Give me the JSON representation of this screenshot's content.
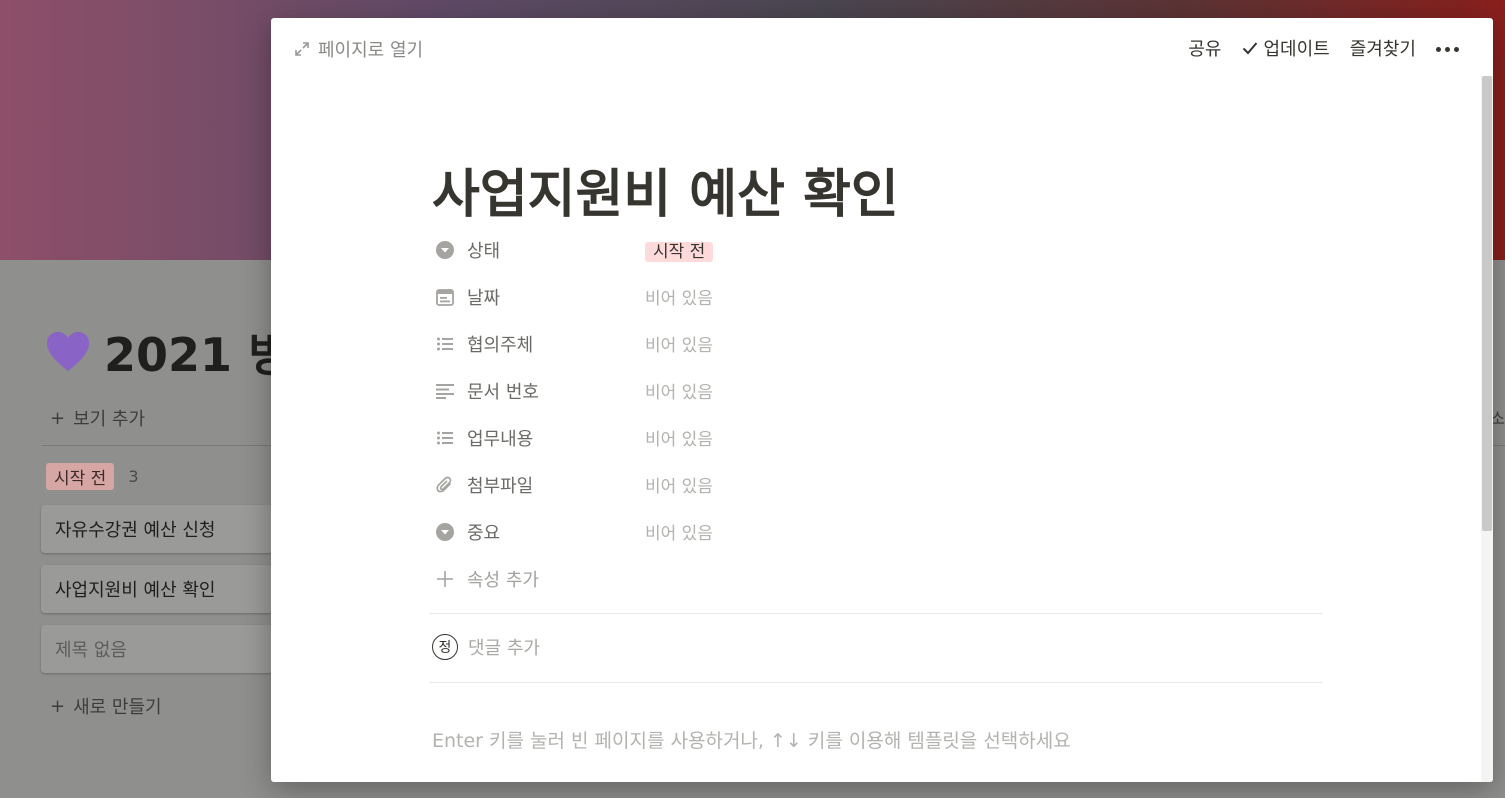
{
  "background": {
    "board_title": "2021 빙",
    "add_view": "보기 추가",
    "group": {
      "label": "시작 전",
      "count": "3"
    },
    "cards": [
      "자유수강권 예산 신청",
      "사업지원비 예산 확인",
      "제목 없음"
    ],
    "new_item": "새로 만들기",
    "right_edge_text": "소"
  },
  "modal": {
    "open_page": "페이지로 열기",
    "actions": {
      "share": "공유",
      "updates": "업데이트",
      "favorite": "즐겨찾기"
    },
    "title": "사업지원비 예산 확인",
    "properties": [
      {
        "icon": "select-icon",
        "name": "상태",
        "value": "시작 전",
        "type": "tag"
      },
      {
        "icon": "calendar-icon",
        "name": "날짜",
        "value": "비어 있음"
      },
      {
        "icon": "list-icon",
        "name": "협의주체",
        "value": "비어 있음"
      },
      {
        "icon": "text-icon",
        "name": "문서 번호",
        "value": "비어 있음"
      },
      {
        "icon": "list-icon",
        "name": "업무내용",
        "value": "비어 있음"
      },
      {
        "icon": "paperclip-icon",
        "name": "첨부파일",
        "value": "비어 있음"
      },
      {
        "icon": "select-icon",
        "name": "중요",
        "value": "비어 있음"
      }
    ],
    "add_property": "속성 추가",
    "comment": {
      "avatar": "정",
      "placeholder": "댓글 추가"
    },
    "hint": "Enter 키를 눌러 빈 페이지를 사용하거나, ↑↓ 키를 이용해 템플릿을 선택하세요"
  },
  "colors": {
    "status_tag_bg": "#ffdada",
    "heart": "#8a63c6"
  }
}
